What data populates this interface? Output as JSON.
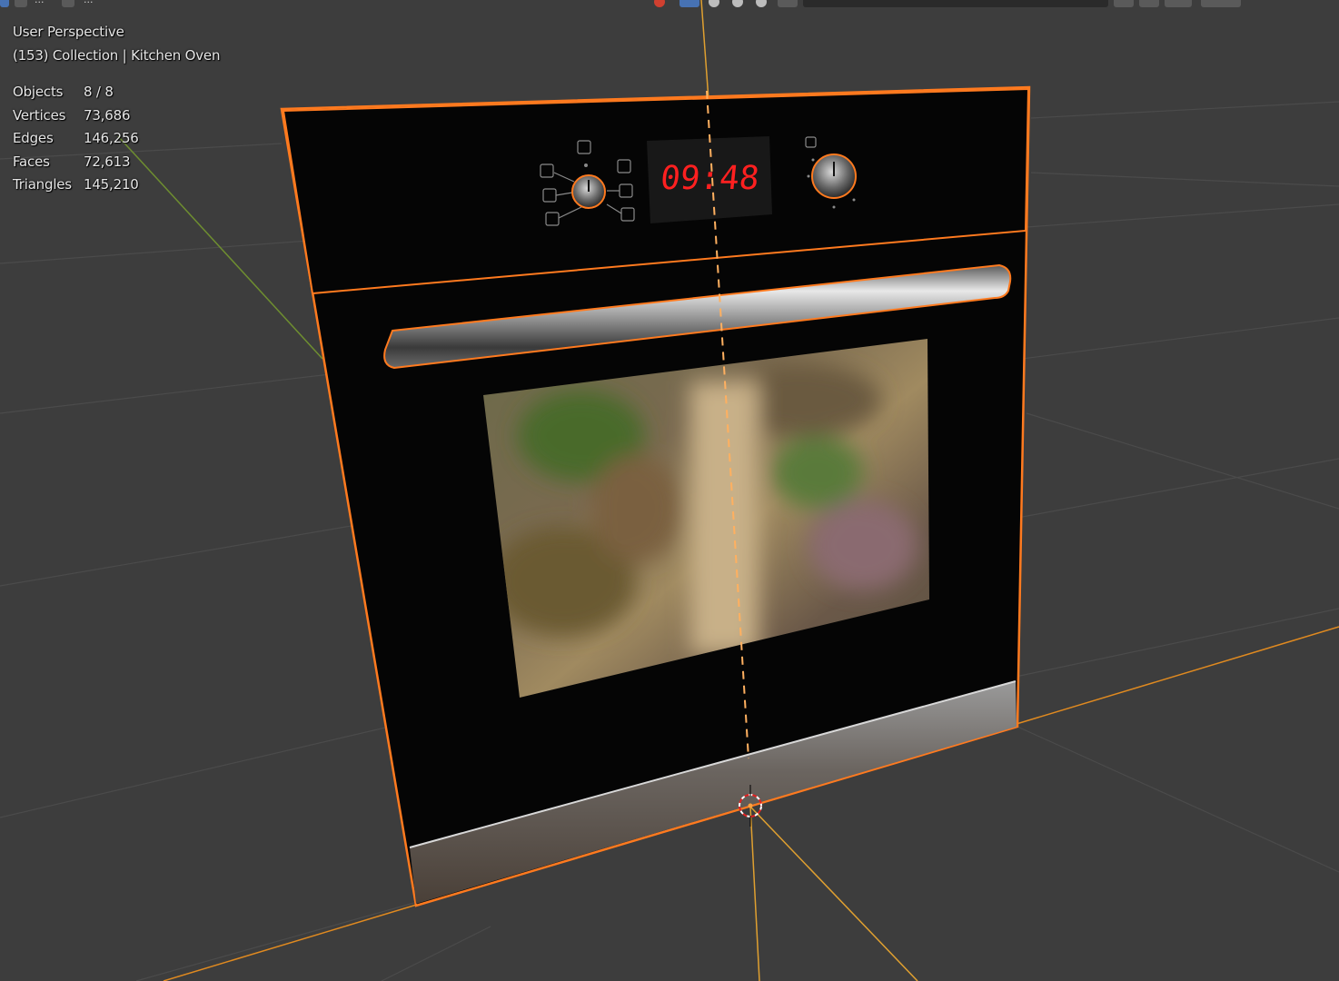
{
  "viewport": {
    "view_name": "User Perspective",
    "context": "(153) Collection | Kitchen Oven"
  },
  "stats": [
    {
      "label": "Objects",
      "value": "8 / 8"
    },
    {
      "label": "Vertices",
      "value": "73,686"
    },
    {
      "label": "Edges",
      "value": "146,256"
    },
    {
      "label": "Faces",
      "value": "72,613"
    },
    {
      "label": "Triangles",
      "value": "145,210"
    }
  ],
  "oven": {
    "clock_display": "09:48"
  },
  "header": {
    "menu_dots": [
      "...",
      "..."
    ]
  },
  "colors": {
    "background": "#3d3d3d",
    "grid_line": "#4a4a4a",
    "selection_outline": "#ff7a1f",
    "x_axis": "#f0a030",
    "y_axis": "#7a9a3a",
    "clock_red": "#ff2020"
  },
  "icons": [
    "cursor-3d-icon",
    "viewport-shading-icons",
    "overlay-icons",
    "gizmo-icons"
  ]
}
